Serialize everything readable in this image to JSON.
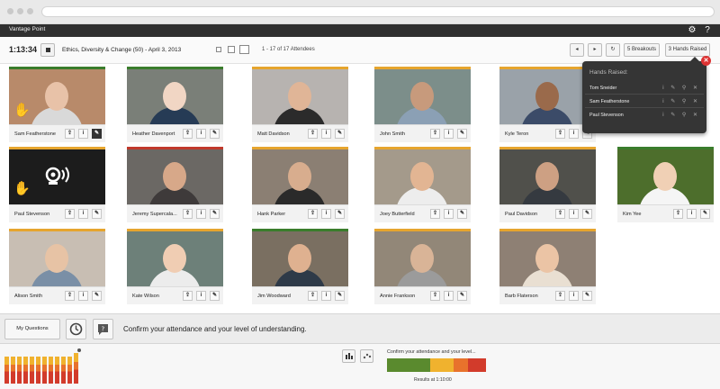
{
  "app": {
    "title": "Vantage Point"
  },
  "session": {
    "time": "1:13:34",
    "course": "Ethics, Diversity & Change (50) - April 3, 2013",
    "attendees": "1 - 17 of 17 Attendees",
    "breakouts_label": "5 Breakouts",
    "hands_raised_label": "3 Hands Raised"
  },
  "tiles": [
    {
      "name": "Sam Featherstone",
      "status_color": "#3a7d2c",
      "bg": "#b88a6a",
      "face": "#e8c2a8",
      "shirt": "#d9d9d9",
      "hand": true,
      "active": true
    },
    {
      "name": "Heather Davenport",
      "status_color": "#3a7d2c",
      "bg": "#7a7f78",
      "face": "#f1d6c4",
      "shirt": "#263b55",
      "hand": false,
      "active": false
    },
    {
      "name": "Matt Davidson",
      "status_color": "#e6a52e",
      "bg": "#b7b3b0",
      "face": "#e0b597",
      "shirt": "#2b2b2b",
      "hand": false,
      "active": false
    },
    {
      "name": "John Smith",
      "status_color": "#e6a52e",
      "bg": "#7c8e8a",
      "face": "#c79a7c",
      "shirt": "#8ba0b5",
      "hand": false,
      "active": false
    },
    {
      "name": "Kyle Teron",
      "status_color": "#e6a52e",
      "bg": "#9aa2a9",
      "face": "#9a6a4b",
      "shirt": "#3b4b68",
      "hand": false,
      "active": false
    },
    {
      "name": "Paul Stevenson",
      "status_color": "#e6a52e",
      "bg": "#1c1c1c",
      "face": "#1c1c1c",
      "shirt": "#1c1c1c",
      "hand": true,
      "active": false,
      "webcam_off": true
    },
    {
      "name": "Jeremy Supercala...",
      "status_color": "#c0392b",
      "bg": "#6b6864",
      "face": "#d7a889",
      "shirt": "#3e3a3a",
      "hand": false,
      "active": false
    },
    {
      "name": "Hank Parker",
      "status_color": "#e6a52e",
      "bg": "#8b7f73",
      "face": "#d8ad8e",
      "shirt": "#2a2a2a",
      "hand": false,
      "active": false
    },
    {
      "name": "Joey Butterfield",
      "status_color": "#e6a52e",
      "bg": "#a49a8b",
      "face": "#e2b593",
      "shirt": "#ededed",
      "hand": false,
      "active": false
    },
    {
      "name": "Paul Davidson",
      "status_color": "#e6a52e",
      "bg": "#50504b",
      "face": "#cda083",
      "shirt": "#353a40",
      "hand": false,
      "active": false
    },
    {
      "name": "Kim Yee",
      "status_color": "#3a7d2c",
      "bg": "#4d6e2c",
      "face": "#f0d0b5",
      "shirt": "#f5f5f5",
      "hand": false,
      "active": false
    },
    {
      "name": "Alison Smith",
      "status_color": "#e6a52e",
      "bg": "#c8beb3",
      "face": "#e7c3a5",
      "shirt": "#7a8fa6",
      "hand": false,
      "active": false
    },
    {
      "name": "Kate Wilson",
      "status_color": "#e6a52e",
      "bg": "#6d8079",
      "face": "#f0cdb3",
      "shirt": "#ececec",
      "hand": false,
      "active": false
    },
    {
      "name": "Jim Woodward",
      "status_color": "#3a7d2c",
      "bg": "#7a6f61",
      "face": "#dfb190",
      "shirt": "#2e3a48",
      "hand": false,
      "active": false
    },
    {
      "name": "Annie Frankson",
      "status_color": "#e6a52e",
      "bg": "#928778",
      "face": "#d9b497",
      "shirt": "#9b9b9b",
      "hand": false,
      "active": false
    },
    {
      "name": "Barb Flaterson",
      "status_color": "#e6a52e",
      "bg": "#8e8074",
      "face": "#ebc4a5",
      "shirt": "#e9dfd2",
      "hand": false,
      "active": false
    }
  ],
  "popup": {
    "title": "Hands Raised:",
    "rows": [
      {
        "name": "Tom Sneider"
      },
      {
        "name": "Sam Featherstone"
      },
      {
        "name": "Paul Stevenson"
      }
    ]
  },
  "question": {
    "my_questions": "My Questions",
    "text": "Confirm your attendance and your level of understanding."
  },
  "results": {
    "title": "Confirm your attendance and your level...",
    "footer": "Results at 1:10:00",
    "segments": [
      {
        "color": "#5a8a2e",
        "fraction": 0.39
      },
      {
        "color": "#f0b22e",
        "fraction": 0.21
      },
      {
        "color": "#e8722c",
        "fraction": 0.13
      },
      {
        "color": "#d23b2b",
        "fraction": 0.16
      }
    ],
    "engagement_colors": [
      "#5a8a2e",
      "#f0b22e",
      "#e8722c",
      "#d23b2b"
    ]
  }
}
